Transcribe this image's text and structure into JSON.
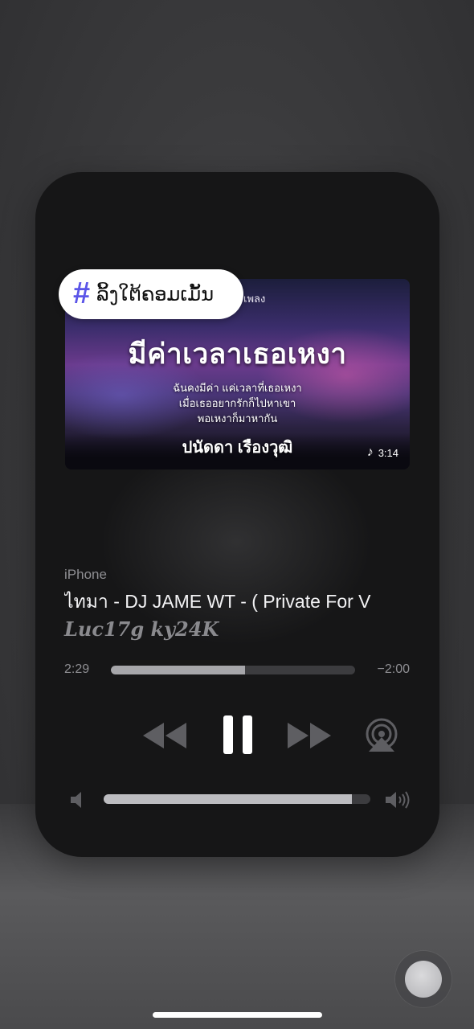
{
  "artwork": {
    "header_text": "เพลง",
    "title": "มีค่าเวลาเธอเหงา",
    "lyrics": [
      "ฉันคงมีค่า แค่เวลาที่เธอเหงา",
      "เมื่อเธออยากรักก็ไปหาเขา",
      "พอเหงาก็มาหากัน"
    ],
    "artist_text": "ปนัดดา เรืองวุฒิ",
    "duration": "3:14",
    "note_icon": "music-note-icon"
  },
  "hashtag": {
    "symbol": "#",
    "text": "ລິ້ງໃຕ້ຄອມເມັ້ນ",
    "accent": "#5b55e8"
  },
  "player": {
    "source": "iPhone",
    "song_title": "ไทมา - DJ JAME WT - ( Private For V",
    "artist": "Luc17g ky24K",
    "elapsed": "2:29",
    "remaining": "−2:00",
    "progress_fraction": 0.55,
    "state": "playing",
    "volume_fraction": 0.93
  },
  "controls": {
    "rewind_icon": "rewind-icon",
    "pause_icon": "pause-icon",
    "forward_icon": "fast-forward-icon",
    "airplay_icon": "airplay-icon",
    "volume_low_icon": "speaker-low-icon",
    "volume_high_icon": "speaker-high-icon"
  }
}
